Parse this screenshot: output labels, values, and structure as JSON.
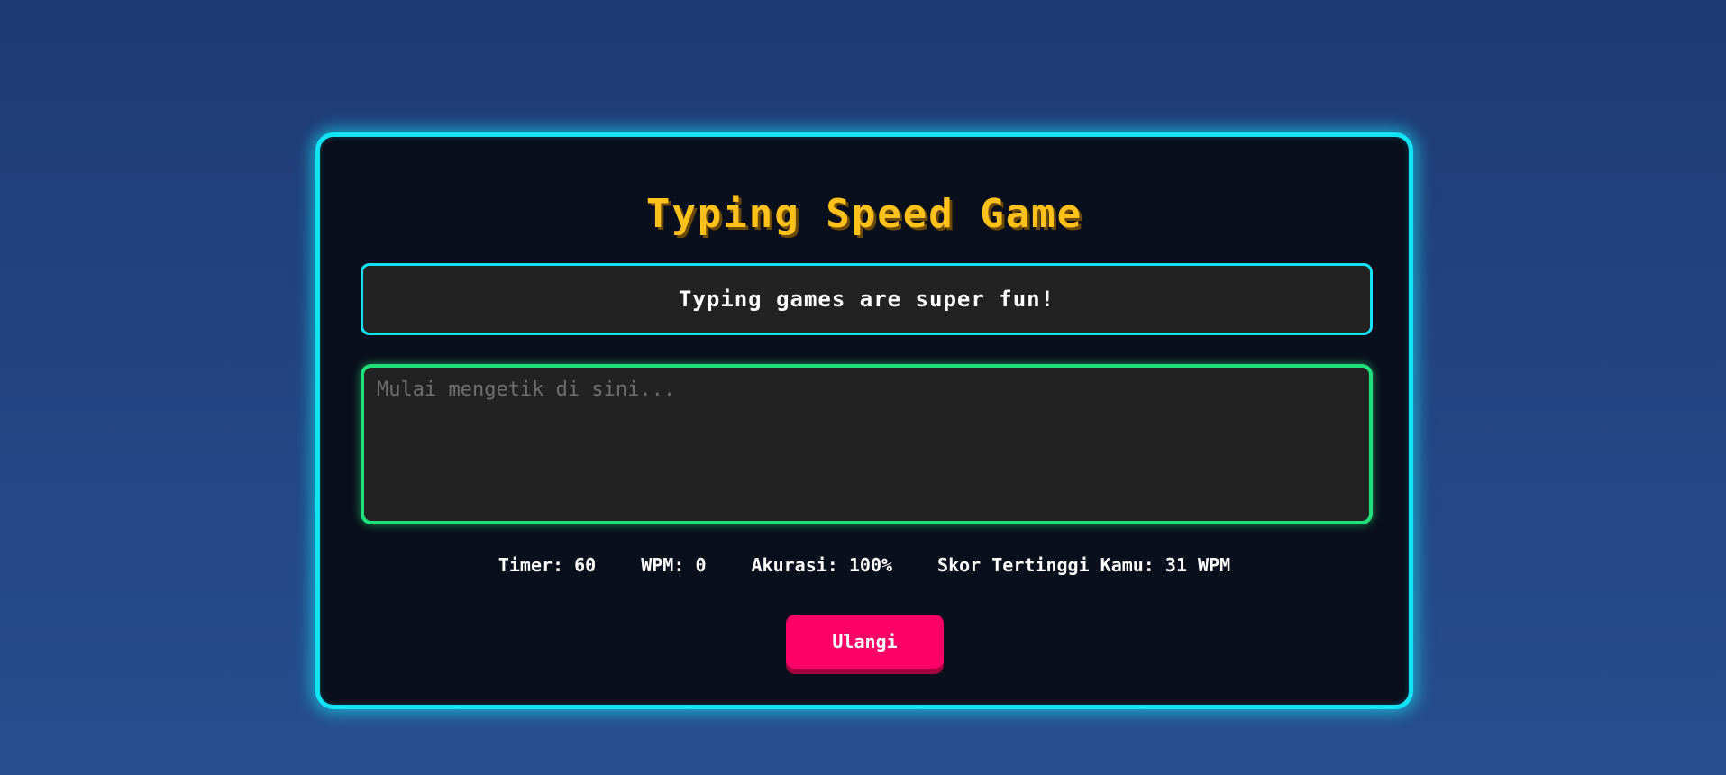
{
  "game": {
    "title": "Typing Speed Game",
    "sentence": "Typing games are super fun!",
    "input_value": "",
    "input_placeholder": "Mulai mengetik di sini...",
    "restart_label": "Ulangi"
  },
  "stats": {
    "timer_label": "Timer:",
    "timer_value": "60",
    "wpm_label": "WPM:",
    "wpm_value": "0",
    "accuracy_label": "Akurasi:",
    "accuracy_value": "100%",
    "highscore_label": "Skor Tertinggi Kamu:",
    "highscore_value": "31",
    "highscore_unit": "WPM"
  },
  "colors": {
    "background": "#274e8f",
    "card_background": "#0a0f1c",
    "card_border": "#12e4f5",
    "title": "#ffc21a",
    "sentence_border": "#12e4f5",
    "input_border": "#1fe07a",
    "restart_button": "#ff0066"
  }
}
